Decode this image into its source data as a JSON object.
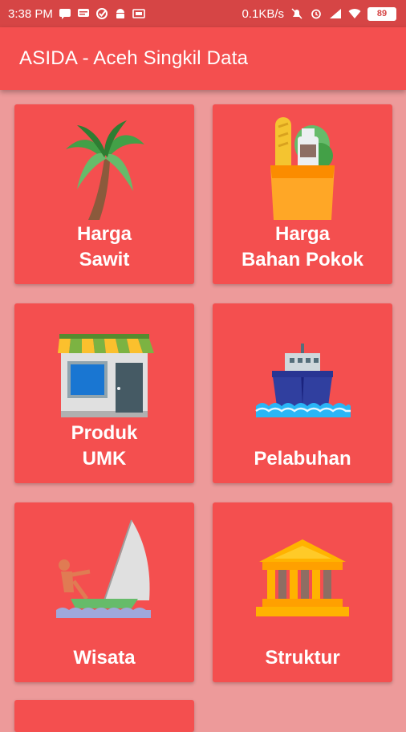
{
  "status_bar": {
    "time": "3:38 PM",
    "network_speed": "0.1KB/s",
    "battery": "89",
    "background_color": "#D64545"
  },
  "app_bar": {
    "title": "ASIDA - Aceh Singkil Data",
    "color": "#F44F4F"
  },
  "menu": [
    {
      "line1": "Harga",
      "line2": "Sawit",
      "icon": "palm-tree-icon"
    },
    {
      "line1": "Harga",
      "line2": "Bahan Pokok",
      "icon": "grocery-bag-icon"
    },
    {
      "line1": "Produk",
      "line2": "UMK",
      "icon": "shop-icon"
    },
    {
      "line1": "Pelabuhan",
      "line2": "",
      "icon": "ship-icon"
    },
    {
      "line1": "Wisata",
      "line2": "",
      "icon": "windsurf-icon"
    },
    {
      "line1": "Struktur",
      "line2": "",
      "icon": "government-building-icon"
    }
  ],
  "colors": {
    "card": "#F44F4F",
    "background": "#ED9A9A"
  }
}
